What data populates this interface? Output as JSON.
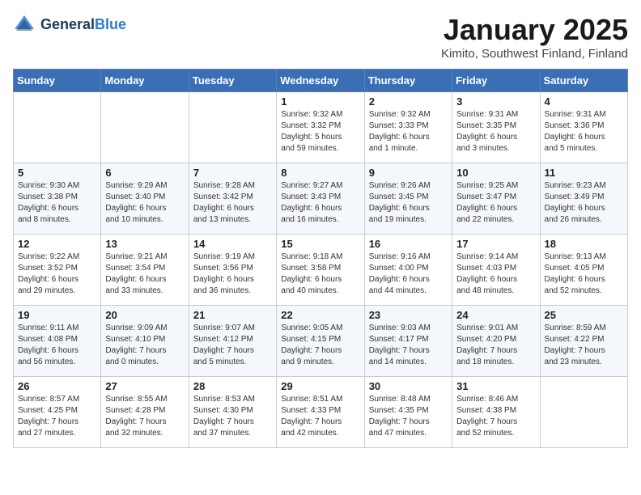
{
  "logo": {
    "general": "General",
    "blue": "Blue"
  },
  "header": {
    "month": "January 2025",
    "location": "Kimito, Southwest Finland, Finland"
  },
  "weekdays": [
    "Sunday",
    "Monday",
    "Tuesday",
    "Wednesday",
    "Thursday",
    "Friday",
    "Saturday"
  ],
  "weeks": [
    [
      {
        "day": "",
        "info": ""
      },
      {
        "day": "",
        "info": ""
      },
      {
        "day": "",
        "info": ""
      },
      {
        "day": "1",
        "info": "Sunrise: 9:32 AM\nSunset: 3:32 PM\nDaylight: 5 hours\nand 59 minutes."
      },
      {
        "day": "2",
        "info": "Sunrise: 9:32 AM\nSunset: 3:33 PM\nDaylight: 6 hours\nand 1 minute."
      },
      {
        "day": "3",
        "info": "Sunrise: 9:31 AM\nSunset: 3:35 PM\nDaylight: 6 hours\nand 3 minutes."
      },
      {
        "day": "4",
        "info": "Sunrise: 9:31 AM\nSunset: 3:36 PM\nDaylight: 6 hours\nand 5 minutes."
      }
    ],
    [
      {
        "day": "5",
        "info": "Sunrise: 9:30 AM\nSunset: 3:38 PM\nDaylight: 6 hours\nand 8 minutes."
      },
      {
        "day": "6",
        "info": "Sunrise: 9:29 AM\nSunset: 3:40 PM\nDaylight: 6 hours\nand 10 minutes."
      },
      {
        "day": "7",
        "info": "Sunrise: 9:28 AM\nSunset: 3:42 PM\nDaylight: 6 hours\nand 13 minutes."
      },
      {
        "day": "8",
        "info": "Sunrise: 9:27 AM\nSunset: 3:43 PM\nDaylight: 6 hours\nand 16 minutes."
      },
      {
        "day": "9",
        "info": "Sunrise: 9:26 AM\nSunset: 3:45 PM\nDaylight: 6 hours\nand 19 minutes."
      },
      {
        "day": "10",
        "info": "Sunrise: 9:25 AM\nSunset: 3:47 PM\nDaylight: 6 hours\nand 22 minutes."
      },
      {
        "day": "11",
        "info": "Sunrise: 9:23 AM\nSunset: 3:49 PM\nDaylight: 6 hours\nand 26 minutes."
      }
    ],
    [
      {
        "day": "12",
        "info": "Sunrise: 9:22 AM\nSunset: 3:52 PM\nDaylight: 6 hours\nand 29 minutes."
      },
      {
        "day": "13",
        "info": "Sunrise: 9:21 AM\nSunset: 3:54 PM\nDaylight: 6 hours\nand 33 minutes."
      },
      {
        "day": "14",
        "info": "Sunrise: 9:19 AM\nSunset: 3:56 PM\nDaylight: 6 hours\nand 36 minutes."
      },
      {
        "day": "15",
        "info": "Sunrise: 9:18 AM\nSunset: 3:58 PM\nDaylight: 6 hours\nand 40 minutes."
      },
      {
        "day": "16",
        "info": "Sunrise: 9:16 AM\nSunset: 4:00 PM\nDaylight: 6 hours\nand 44 minutes."
      },
      {
        "day": "17",
        "info": "Sunrise: 9:14 AM\nSunset: 4:03 PM\nDaylight: 6 hours\nand 48 minutes."
      },
      {
        "day": "18",
        "info": "Sunrise: 9:13 AM\nSunset: 4:05 PM\nDaylight: 6 hours\nand 52 minutes."
      }
    ],
    [
      {
        "day": "19",
        "info": "Sunrise: 9:11 AM\nSunset: 4:08 PM\nDaylight: 6 hours\nand 56 minutes."
      },
      {
        "day": "20",
        "info": "Sunrise: 9:09 AM\nSunset: 4:10 PM\nDaylight: 7 hours\nand 0 minutes."
      },
      {
        "day": "21",
        "info": "Sunrise: 9:07 AM\nSunset: 4:12 PM\nDaylight: 7 hours\nand 5 minutes."
      },
      {
        "day": "22",
        "info": "Sunrise: 9:05 AM\nSunset: 4:15 PM\nDaylight: 7 hours\nand 9 minutes."
      },
      {
        "day": "23",
        "info": "Sunrise: 9:03 AM\nSunset: 4:17 PM\nDaylight: 7 hours\nand 14 minutes."
      },
      {
        "day": "24",
        "info": "Sunrise: 9:01 AM\nSunset: 4:20 PM\nDaylight: 7 hours\nand 18 minutes."
      },
      {
        "day": "25",
        "info": "Sunrise: 8:59 AM\nSunset: 4:22 PM\nDaylight: 7 hours\nand 23 minutes."
      }
    ],
    [
      {
        "day": "26",
        "info": "Sunrise: 8:57 AM\nSunset: 4:25 PM\nDaylight: 7 hours\nand 27 minutes."
      },
      {
        "day": "27",
        "info": "Sunrise: 8:55 AM\nSunset: 4:28 PM\nDaylight: 7 hours\nand 32 minutes."
      },
      {
        "day": "28",
        "info": "Sunrise: 8:53 AM\nSunset: 4:30 PM\nDaylight: 7 hours\nand 37 minutes."
      },
      {
        "day": "29",
        "info": "Sunrise: 8:51 AM\nSunset: 4:33 PM\nDaylight: 7 hours\nand 42 minutes."
      },
      {
        "day": "30",
        "info": "Sunrise: 8:48 AM\nSunset: 4:35 PM\nDaylight: 7 hours\nand 47 minutes."
      },
      {
        "day": "31",
        "info": "Sunrise: 8:46 AM\nSunset: 4:38 PM\nDaylight: 7 hours\nand 52 minutes."
      },
      {
        "day": "",
        "info": ""
      }
    ]
  ]
}
